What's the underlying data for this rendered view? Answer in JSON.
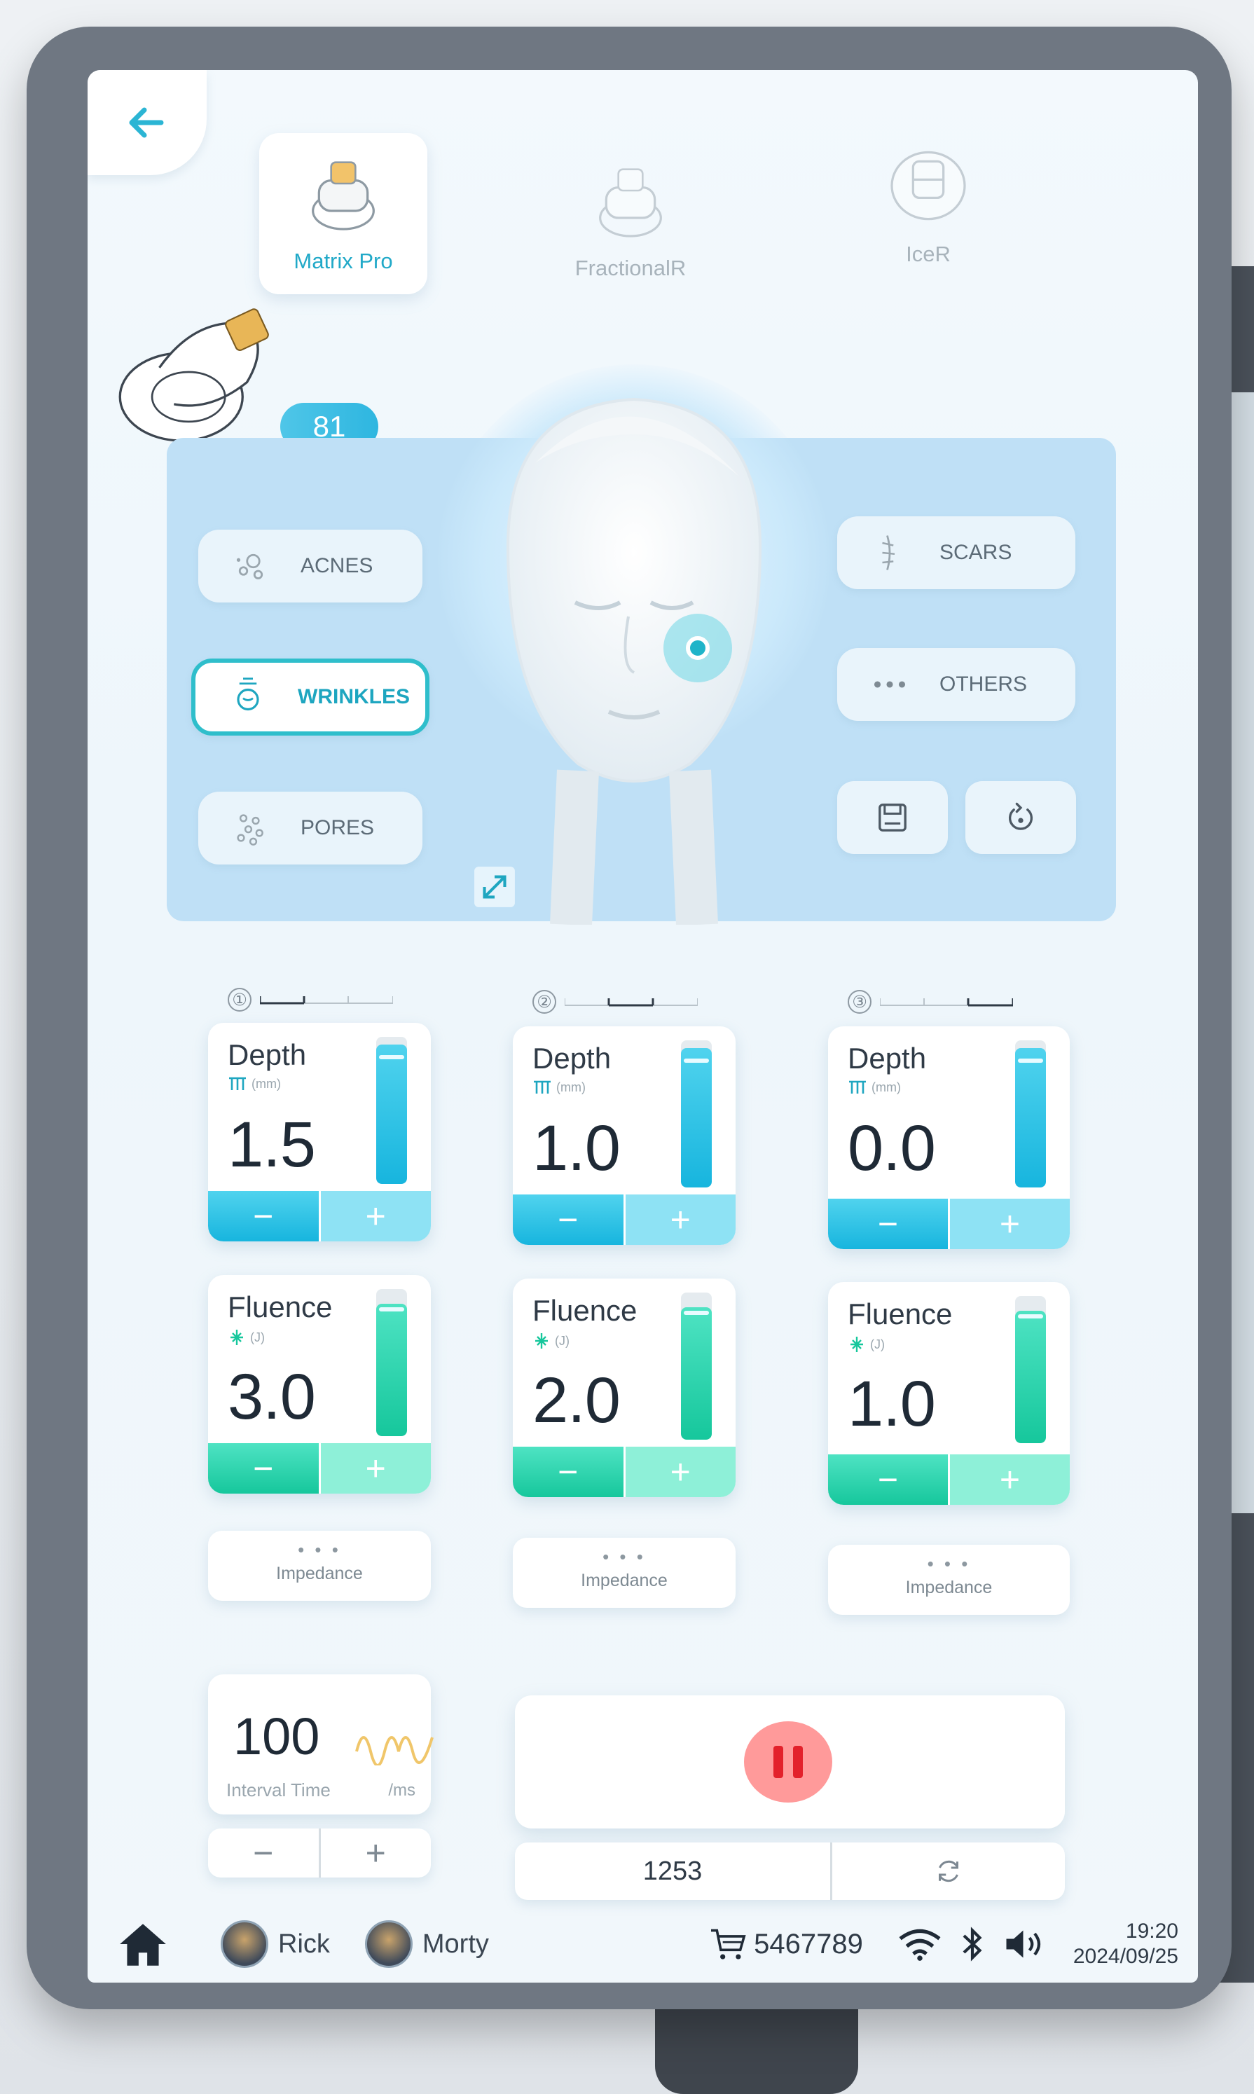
{
  "handpieces": [
    {
      "label": "Matrix Pro",
      "active": true
    },
    {
      "label": "FractionalR",
      "active": false
    },
    {
      "label": "IceR",
      "active": false
    }
  ],
  "counter_badge": "81",
  "indications": {
    "left": [
      {
        "label": "ACNES",
        "icon": "acne-icon",
        "active": false
      },
      {
        "label": "WRINKLES",
        "icon": "wrinkle-icon",
        "active": true
      },
      {
        "label": "PORES",
        "icon": "pores-icon",
        "active": false
      }
    ],
    "right": [
      {
        "label": "SCARS",
        "icon": "scar-icon"
      },
      {
        "label": "OTHERS",
        "icon": "more-dots-icon"
      }
    ]
  },
  "channels": [
    {
      "number": "①",
      "depth": {
        "label": "Depth",
        "unit": "(mm)",
        "value": "1.5",
        "level": 0.95
      },
      "fluence": {
        "label": "Fluence",
        "unit": "(J)",
        "value": "3.0",
        "level": 0.9
      },
      "impedance": {
        "dots": "• • •",
        "label": "Impedance"
      }
    },
    {
      "number": "②",
      "depth": {
        "label": "Depth",
        "unit": "(mm)",
        "value": "1.0",
        "level": 0.95
      },
      "fluence": {
        "label": "Fluence",
        "unit": "(J)",
        "value": "2.0",
        "level": 0.9
      },
      "impedance": {
        "dots": "• • •",
        "label": "Impedance"
      }
    },
    {
      "number": "③",
      "depth": {
        "label": "Depth",
        "unit": "(mm)",
        "value": "0.0",
        "level": 0.95
      },
      "fluence": {
        "label": "Fluence",
        "unit": "(J)",
        "value": "1.0",
        "level": 0.9
      },
      "impedance": {
        "dots": "• • •",
        "label": "Impedance"
      }
    }
  ],
  "controls": {
    "minus": "−",
    "plus": "+"
  },
  "interval": {
    "value": "100",
    "label": "Interval Time",
    "unit": "/ms"
  },
  "shot_count": "1253",
  "status_bar": {
    "users": [
      "Rick",
      "Morty"
    ],
    "cart_number": "5467789",
    "time": "19:20",
    "date": "2024/09/25"
  },
  "colors": {
    "accent": "#21a9c8",
    "depth": "#17b5de",
    "fluence": "#16c79c",
    "pause": "#e3212b"
  }
}
